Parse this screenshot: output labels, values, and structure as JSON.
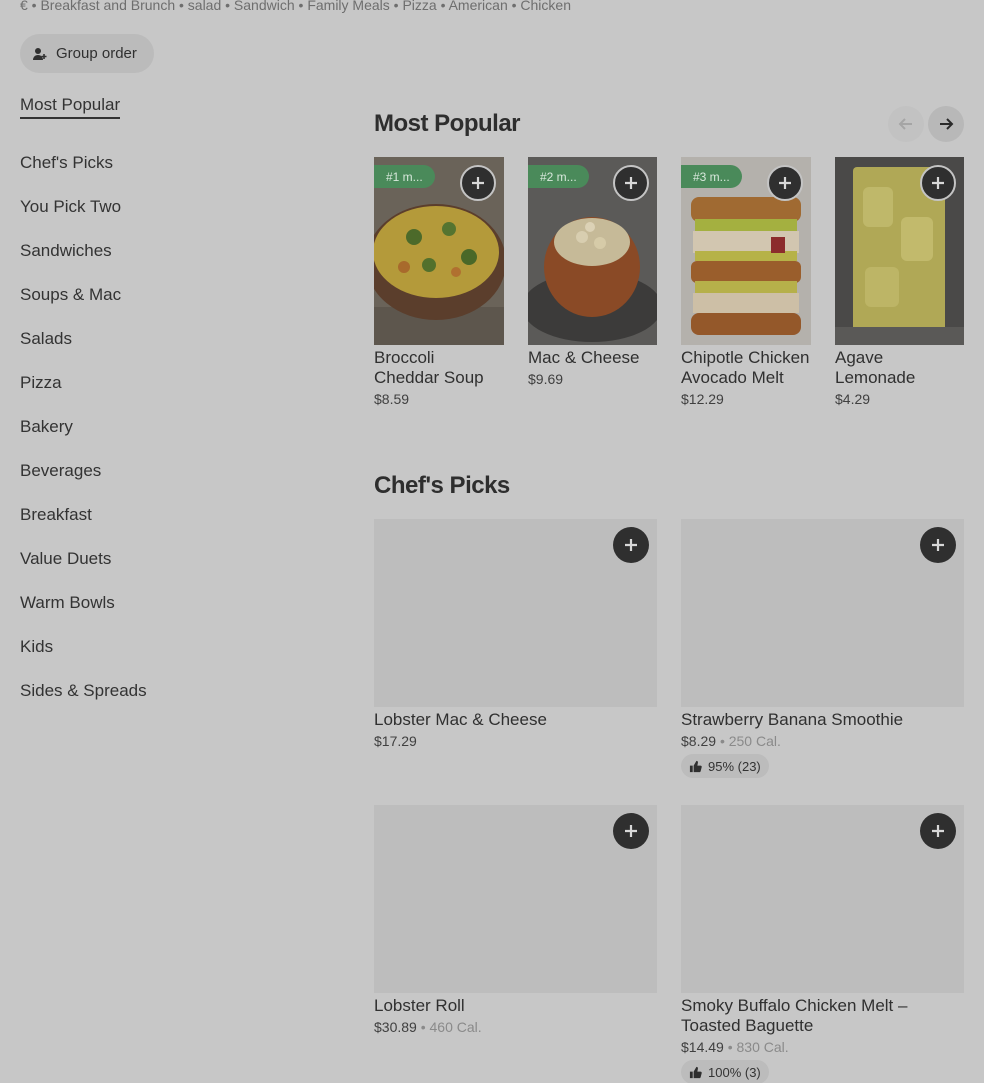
{
  "header": {
    "tagline": "€ • Breakfast and Brunch • salad • Sandwich • Family Meals • Pizza • American • Chicken",
    "group_order_label": "Group order"
  },
  "sidebar": {
    "items": [
      {
        "label": "Most Popular"
      },
      {
        "label": "Chef's Picks"
      },
      {
        "label": "You Pick Two"
      },
      {
        "label": "Sandwiches"
      },
      {
        "label": "Soups & Mac"
      },
      {
        "label": "Salads"
      },
      {
        "label": "Pizza"
      },
      {
        "label": "Bakery"
      },
      {
        "label": "Beverages"
      },
      {
        "label": "Breakfast"
      },
      {
        "label": "Value Duets"
      },
      {
        "label": "Warm Bowls"
      },
      {
        "label": "Kids"
      },
      {
        "label": "Sides & Spreads"
      }
    ]
  },
  "most_popular": {
    "title": "Most Popular",
    "items": [
      {
        "rank": "#1 m...",
        "name": "Broccoli Cheddar Soup",
        "price": "$8.59"
      },
      {
        "rank": "#2 m...",
        "name": "Mac & Cheese",
        "price": "$9.69"
      },
      {
        "rank": "#3 m...",
        "name": "Chipotle Chicken Avocado Melt",
        "price": "$12.29"
      },
      {
        "rank": "",
        "name": "Agave Lemonade",
        "price": "$4.29"
      }
    ]
  },
  "chefs_picks": {
    "title": "Chef's Picks",
    "items": [
      {
        "name": "Lobster Mac & Cheese",
        "price": "$17.29",
        "cal": "",
        "rating": ""
      },
      {
        "name": "Strawberry Banana Smoothie",
        "price": "$8.29",
        "cal": "250 Cal.",
        "rating": "95% (23)"
      },
      {
        "name": "Lobster Roll",
        "price": "$30.89",
        "cal": "460 Cal.",
        "rating": ""
      },
      {
        "name": "Smoky Buffalo Chicken Melt – Toasted Baguette",
        "price": "$14.49",
        "cal": "830 Cal.",
        "rating": "100% (3)"
      }
    ]
  },
  "colors": {
    "background": "#c7c7c7",
    "rank_badge": "#4a8a5a",
    "add_button": "#2f2f2f"
  }
}
